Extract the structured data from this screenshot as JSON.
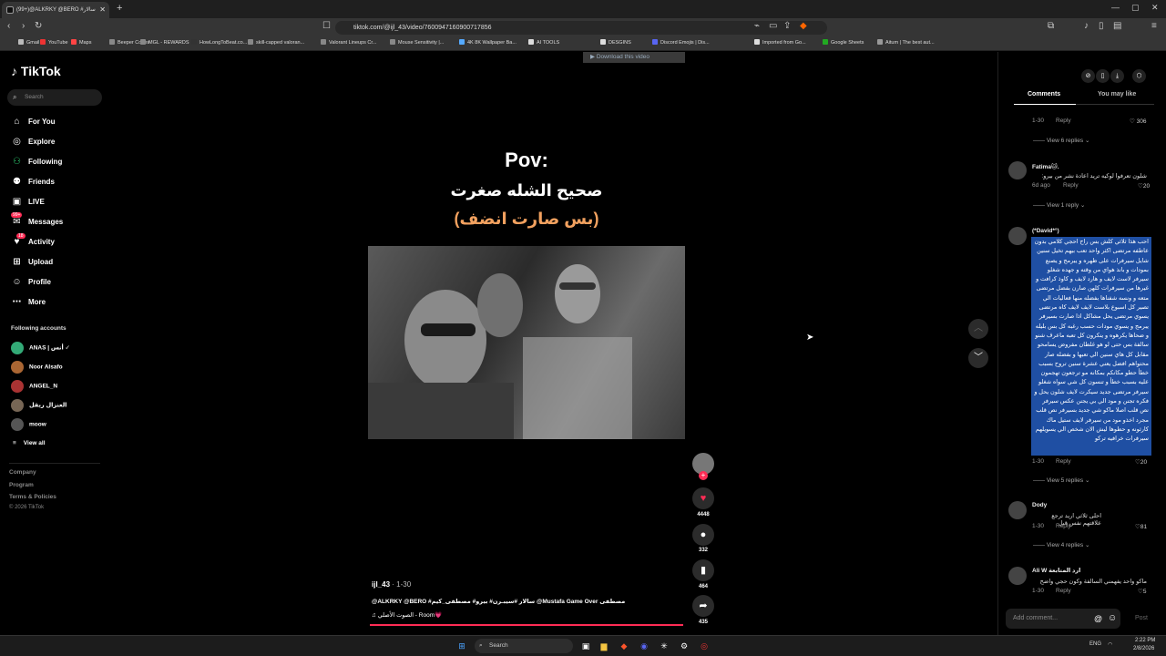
{
  "browser": {
    "tab_title": "(99+)@ALKRKY @BERO #سالار",
    "url": "tiktok.com/@ijl_43/video/7600947160900717856",
    "bookmarks": [
      "Gmail",
      "YouTube",
      "Maps",
      "Beeper Codes",
      "MGL - REWARDS",
      "HowLongToBeat.co...",
      "skill-capped valoran...",
      "Valorant Lineups Cr...",
      "Mouse Sensitivity |...",
      "4K 8K Wallpaper Ba...",
      "AI TOOLS",
      "DESGINS",
      "Discord Emojis | Dis...",
      "Imported from Go...",
      "Google Sheets",
      "Aitum | The best aut..."
    ],
    "download_label": "Download this video"
  },
  "sidebar": {
    "logo": "TikTok",
    "search_placeholder": "Search",
    "nav": [
      "For You",
      "Explore",
      "Following",
      "Friends",
      "LIVE",
      "Messages",
      "Activity",
      "Upload",
      "Profile",
      "More"
    ],
    "messages_badge": "99+",
    "activity_badge": "18",
    "following_header": "Following accounts",
    "accounts": [
      "ANAS | أنس ✓",
      "Noor Alsafo",
      "ANGEL_N",
      "العنزال ربقل",
      "moow"
    ],
    "view_all": "View all",
    "footer": [
      "Company",
      "Program",
      "Terms & Policies",
      "© 2026 TikTok"
    ]
  },
  "video": {
    "overlay_line1": "Pov:",
    "overlay_line2": "صحيح الشله صغرت",
    "overlay_line3": "(بس صارت انضف)",
    "author": "ijl_43",
    "date": " · 1-30",
    "description": "@ALKRKY @BERO #سالار #سيبـرن# بيرو# مصطفى_كيم @Mustafa Game Over مصطفى",
    "music": "♫  الصوت الأصلي - Room💗",
    "likes": "4448",
    "comments": "332",
    "saves": "464",
    "shares": "435"
  },
  "panel": {
    "tabs": [
      "Comments",
      "You may like"
    ],
    "comments": [
      {
        "meta": "1-30",
        "reply": "Reply",
        "likes": "306",
        "replies": "View 6 replies"
      },
      {
        "name": "Fatima🐱.",
        "text": "شلون تعرفوا لوكيه تريد اعادة نشر من بيرو:",
        "meta": "6d ago",
        "reply": "Reply",
        "likes": "20",
        "replies": "View 1 reply"
      },
      {
        "name": "(*David*°)",
        "text": "احب هذا ثلاثي كلش بس راح احجي كلامي بدون عاطفه مرتضى اكثر واحد تعب بيهم تخيل سنين شايل سيرفرات على ظهره و يبرمج و يصنع بمودات و بانذ هواي من وقته و جهده شغلو سيرفر لاست لايف و هارد لايف و كاوذ كرافت و غيرها من سيرفرات كلهن صارن بفضل مرتضى متعه و ونسه شفناها بفضله منها فعاليات الي تصير كل اسبوع بلاست لايف لايف كاه مرتضى يسوي مرتضى يحل مشاكل اذا صارت بسيرفر يبرمج و يسوي مودات حسب رغبه كل بس بليله و ضحاها يكرهوه و ينكرون كل تعبه ماعرف شنو سالفة بس حتى لو هو غلطان مفروض يسامحو مقابل كل هاي سنين الي تعبها و بفضله صار محتواهم افضل يعني عشرة سنين تروح بسبب خطأ حطو مكانكم بمكانه مو ترجعون تهجمون عليه بسبب خطأ و تنسون كل شي سواه شغلو سيرفر مرتضى جديد سيكرت لايف شلون يحل و فكره تجنن و مود الي بي يجنن عكس سيرفر نص قلب اصلا ماكو شي جديد بسيرفر نص قلب مجرد اخذو مود من سيرفر لايف ستيل ماك كارثونه و حطوها ليش الان شخص الي يسويلهم سيرفرات خرافيه تركو",
        "meta": "1-30",
        "reply": "Reply",
        "likes": "20",
        "replies": "View 5 replies"
      },
      {
        "name": "Dody",
        "text": "احلى ثلاثي اريد ترجع علاقتهم نفس قبل",
        "meta": "1-30",
        "reply": "Reply",
        "likes": "81",
        "replies": "View 4 replies"
      },
      {
        "name": "Ali W ارد المتابعة",
        "text": "ماكو واحد يفهمني السالفة وكون حجي واضح",
        "meta": "1-30",
        "reply": "Reply",
        "likes": "5"
      }
    ],
    "add_comment_placeholder": "Add comment...",
    "post_label": "Post"
  },
  "taskbar": {
    "search_placeholder": "Search",
    "lang": "ENG",
    "time": "2:22 PM",
    "date": "2/8/2026"
  }
}
